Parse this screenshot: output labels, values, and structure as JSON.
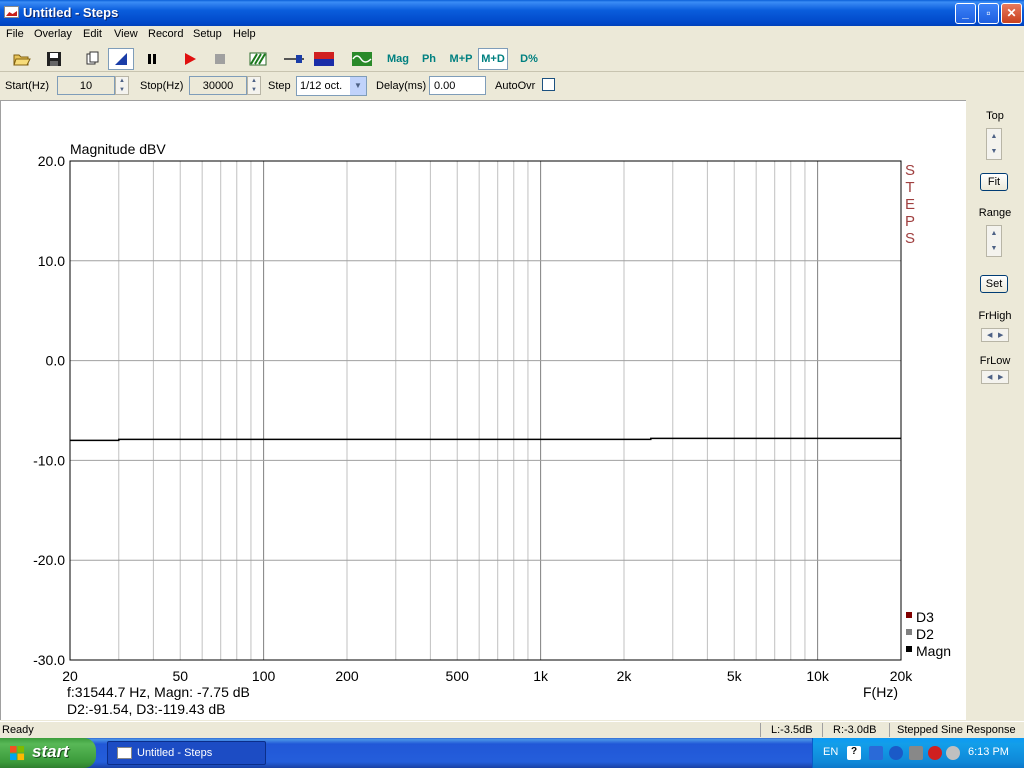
{
  "window": {
    "title": "Untitled - Steps",
    "controls": {
      "minimize": "_",
      "maximize": "▫",
      "close": "✕"
    }
  },
  "menubar": [
    "File",
    "Overlay",
    "Edit",
    "View",
    "Record",
    "Setup",
    "Help"
  ],
  "toolbar": {
    "icons": [
      "open-icon",
      "save-icon",
      "new-icon",
      "cursor-icon",
      "pause-icon",
      "record-icon",
      "stop-icon",
      "overlay-icon",
      "slider-icon",
      "color-icon",
      "wave-icon"
    ],
    "labels": {
      "mag": "Mag",
      "ph": "Ph",
      "mp": "M+P",
      "md": "M+D",
      "dpct": "D%"
    },
    "selected": [
      "cursor",
      "M+D"
    ]
  },
  "params": {
    "start_label": "Start(Hz)",
    "start_value": "10",
    "stop_label": "Stop(Hz)",
    "stop_value": "30000",
    "step_label": "Step",
    "step_value": "1/12 oct.",
    "delay_label": "Delay(ms)",
    "delay_value": "0.00",
    "autoovr_label": "AutoOvr",
    "autoovr_checked": false
  },
  "plot": {
    "readout_line1": "f:31544.7 Hz, Magn: -7.75 dB",
    "readout_line2": "D2:-91.54, D3:-119.43 dB",
    "watermark": "STEPS"
  },
  "chart_data": {
    "type": "line",
    "title": "Magnitude dBV",
    "xlabel": "F(Hz)",
    "ylabel": "Magnitude dBV",
    "x_scale": "log",
    "xlim": [
      20,
      20000
    ],
    "ylim": [
      -30,
      20
    ],
    "grid": true,
    "x_ticks": [
      20,
      50,
      100,
      200,
      500,
      1000,
      2000,
      5000,
      10000,
      20000
    ],
    "x_tick_labels": [
      "20",
      "50",
      "100",
      "200",
      "500",
      "1k",
      "2k",
      "5k",
      "10k",
      "20k"
    ],
    "y_ticks": [
      20,
      10,
      0,
      -10,
      -20,
      -30
    ],
    "y_tick_labels": [
      "20.0",
      "10.0",
      "0.0",
      "-10.0",
      "-20.0",
      "-30.0"
    ],
    "legend_position": "bottom-right",
    "series": [
      {
        "name": "Magn",
        "color": "#000000",
        "x": [
          20,
          30,
          30,
          2500,
          2500,
          20000
        ],
        "y": [
          -8.0,
          -8.0,
          -7.9,
          -7.9,
          -7.8,
          -7.8
        ]
      },
      {
        "name": "D2",
        "color": "#808080",
        "x": [],
        "y": []
      },
      {
        "name": "D3",
        "color": "#800000",
        "x": [],
        "y": []
      }
    ],
    "legend_order": [
      "D3",
      "D2",
      "Magn"
    ]
  },
  "rightpanel": {
    "top_label": "Top",
    "fit_label": "Fit",
    "range_label": "Range",
    "set_label": "Set",
    "frhigh_label": "FrHigh",
    "frlow_label": "FrLow"
  },
  "statusbar": {
    "ready": "Ready",
    "left": "L:-3.5dB",
    "right": "R:-3.0dB",
    "mode": "Stepped Sine Response"
  },
  "taskbar": {
    "start": "start",
    "task_label": "Untitled - Steps",
    "lang": "EN",
    "clock": "6:13 PM"
  }
}
